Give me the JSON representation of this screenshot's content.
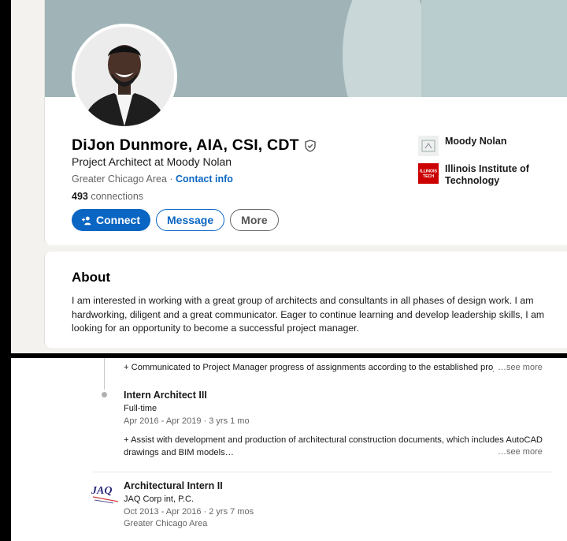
{
  "profile": {
    "name": "DiJon Dunmore, AIA, CSI, CDT",
    "headline": "Project Architect at Moody Nolan",
    "location": "Greater Chicago Area",
    "separator": " · ",
    "contact_info": "Contact info",
    "connections_count": "493",
    "connections_label": " connections"
  },
  "actions": {
    "connect": "Connect",
    "message": "Message",
    "more": "More"
  },
  "orgs": [
    {
      "name": "Moody Nolan",
      "icon": "company-logo-icon"
    },
    {
      "name": "Illinois Institute of Technology",
      "icon": "university-logo-icon",
      "logo_text_1": "ILLINOIS",
      "logo_text_2": "TECH",
      "color": "#cc0000"
    }
  ],
  "about": {
    "title": "About",
    "text": "I am interested in working with a great group of architects and consultants in all phases of design work. I am hardworking, diligent and a great communicator. Eager to continue learning and develop leadership skills, I am looking for an opportunity to become a successful project manager."
  },
  "experience": {
    "prev_line": "+ Communicated to Project Manager progress of assignments according to the established project",
    "see_more": "…see more",
    "item1": {
      "title": "Intern Architect III",
      "type": "Full-time",
      "dates": "Apr 2016 - Apr 2019 · 3 yrs 1 mo",
      "desc": "+ Assist with development and production of architectural construction documents, which includes AutoCAD drawings and BIM models…"
    },
    "item2": {
      "title": "Architectural Intern II",
      "company": "JAQ Corp int, P.C.",
      "dates": "Oct 2013 - Apr 2016 · 2 yrs 7 mos",
      "location": "Greater Chicago Area",
      "logo_text": "JAQ"
    }
  }
}
